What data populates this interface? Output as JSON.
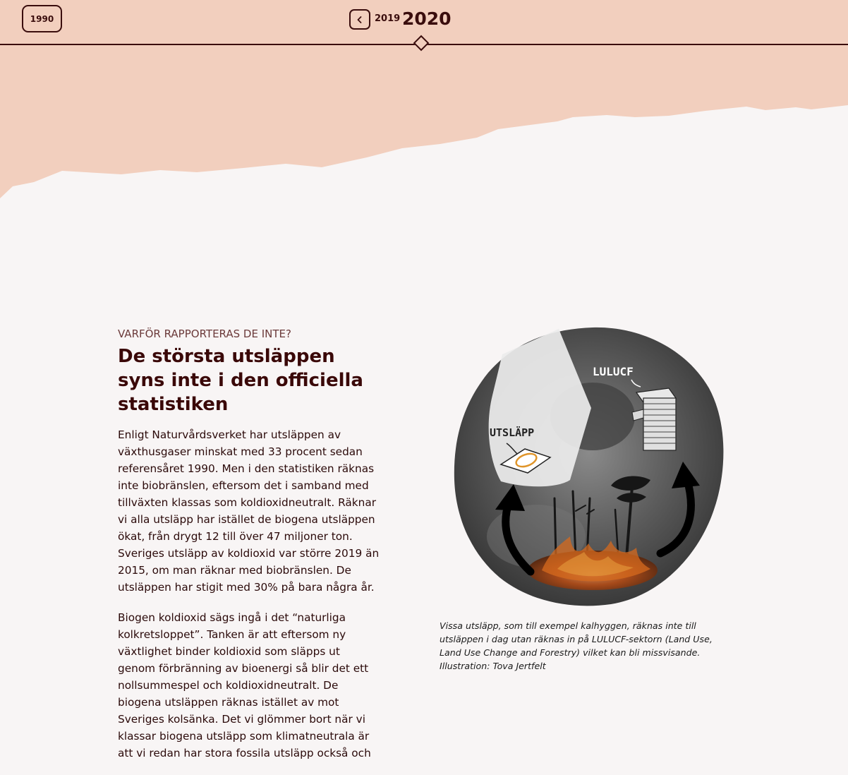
{
  "timeline": {
    "start_year": "1990",
    "prev_year": "2019",
    "current_year": "2020"
  },
  "colors": {
    "band": "#f2cfbe",
    "background": "#f8f5f5",
    "dark": "#3a0d0d"
  },
  "article": {
    "eyebrow": "VARFÖR RAPPORTERAS DE INTE?",
    "headline": "De största utsläppen syns inte i den officiella statistiken",
    "paragraphs": [
      "Enligt Naturvårdsverket har utsläppen av växthusgaser minskat med 33 procent sedan referensåret 1990. Men i den statistiken räknas inte biobränslen, eftersom det i samband med tillväxten klassas som koldioxidneutralt. Räknar vi alla utsläpp har istället de biogena utsläppen ökat, från drygt 12 till över 47 miljoner ton. Sveriges utsläpp av koldioxid var större 2019 än 2015, om man räknar med biobränslen. De utsläppen har stigit med 30% på bara några år.",
      "Biogen koldioxid sägs ingå i det “naturliga kolkretsloppet”. Tanken är att eftersom ny växtlighet binder koldioxid som släpps ut genom förbränning av bioenergi så blir det ett nollsummespel och koldioxidneutralt. De biogena utsläppen räknas istället av mot Sveriges kolsänka. Det vi glömmer bort när vi klassar biogena utsläpp som klimatneutrala är att vi redan har stora fossila utsläpp också och"
    ]
  },
  "illustration": {
    "label_utslapp": "UTSLÄPP",
    "label_lulucf": "LULUCF",
    "caption": "Vissa utsläpp, som till exempel kalhyggen, räknas inte till utsläppen i dag utan räknas in på LULUCF-sektorn (Land Use, Land Use Change and Forestry) vilket kan bli missvisande. Illustration: Tova Jertfelt"
  }
}
